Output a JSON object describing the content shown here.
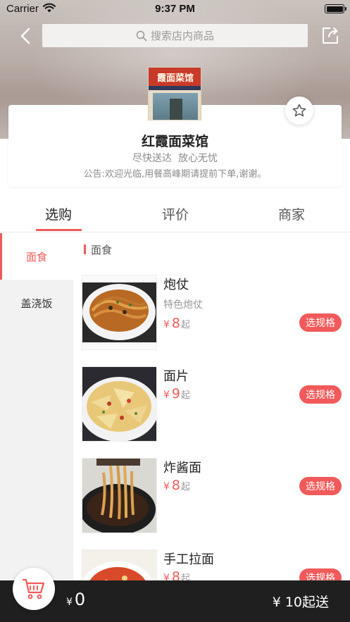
{
  "status_bar": {
    "carrier": "Carrier",
    "time": "9:37 PM"
  },
  "nav": {
    "search_placeholder": "搜索店内商品"
  },
  "store": {
    "logo_sign": "霞面菜馆",
    "name": "红霞面菜馆",
    "slogan": "尽快送达  放心无忧",
    "notice": "公告:欢迎光临,用餐高峰期请提前下单,谢谢。"
  },
  "tabs": [
    {
      "label": "选购",
      "active": true
    },
    {
      "label": "评价",
      "active": false
    },
    {
      "label": "商家",
      "active": false
    }
  ],
  "categories": [
    {
      "label": "面食",
      "active": true
    },
    {
      "label": "盖浇饭",
      "active": false
    }
  ],
  "section": {
    "label": "面食"
  },
  "products": [
    {
      "name": "炮仗",
      "desc": "特色炮仗",
      "currency": "¥",
      "price": "8",
      "suffix": "起",
      "button": "选规格"
    },
    {
      "name": "面片",
      "desc": "",
      "currency": "¥",
      "price": "9",
      "suffix": "起",
      "button": "选规格"
    },
    {
      "name": "炸酱面",
      "desc": "",
      "currency": "¥",
      "price": "8",
      "suffix": "起",
      "button": "选规格"
    },
    {
      "name": "手工拉面",
      "desc": "",
      "currency": "¥",
      "price": "8",
      "suffix": "起",
      "button": "选规格"
    }
  ],
  "cart": {
    "currency": "¥",
    "total": "0",
    "min_order": "¥ 10起送"
  },
  "colors": {
    "accent": "#f05a5a",
    "cart_bar": "#1f1f1f"
  },
  "icons": [
    "wifi-icon",
    "battery-icon",
    "back-icon",
    "search-icon",
    "share-icon",
    "star-icon",
    "cart-icon"
  ]
}
